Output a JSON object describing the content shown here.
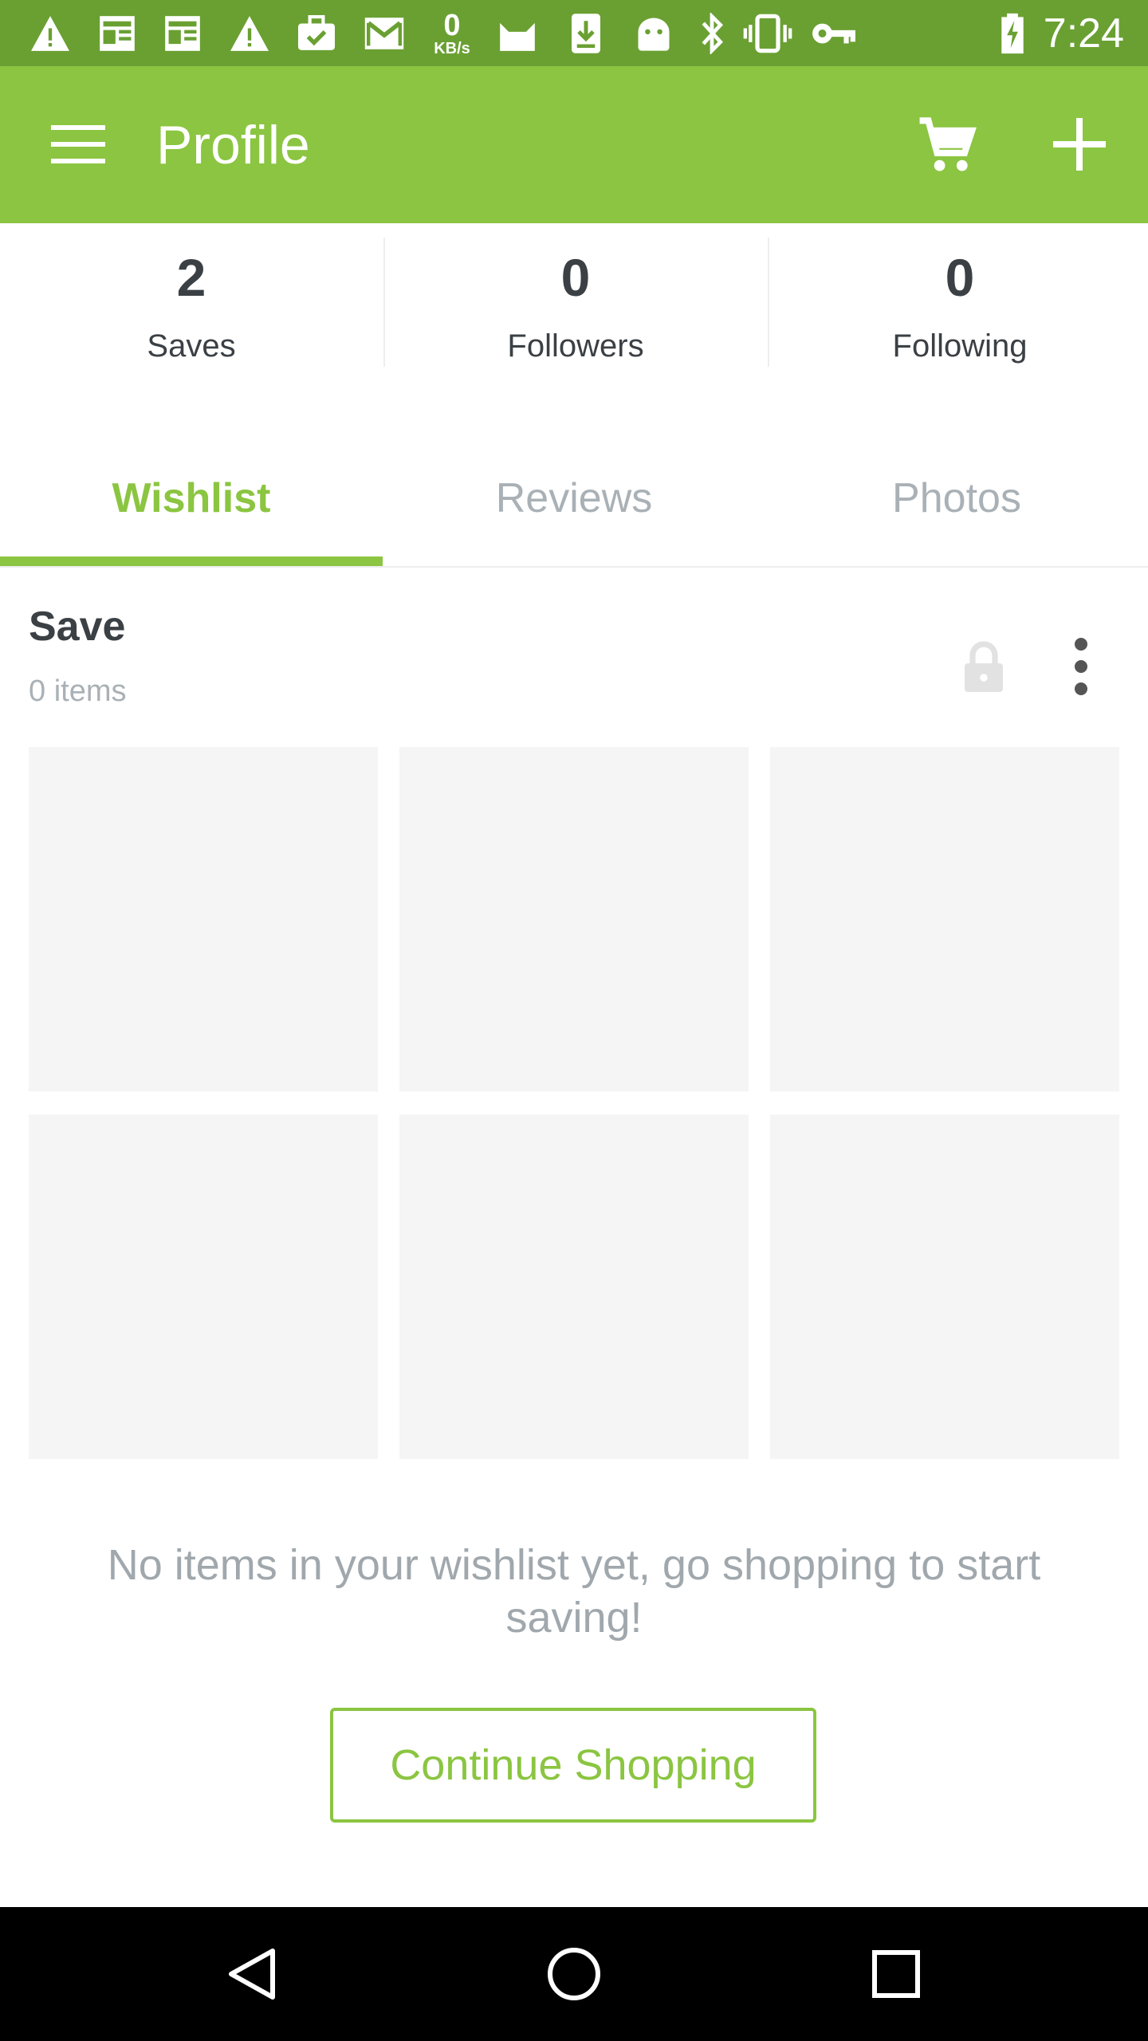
{
  "status_bar": {
    "time": "7:24",
    "net_speed_value": "0",
    "net_speed_unit": "KB/s",
    "icons": [
      "warning-icon",
      "news-icon",
      "news-icon",
      "warning-icon",
      "briefcase-icon",
      "gmail-icon",
      "net-speed",
      "cat-icon",
      "download-icon",
      "android-icon",
      "bluetooth-icon",
      "vibrate-icon",
      "key-icon",
      "battery-icon"
    ]
  },
  "app_bar": {
    "title": "Profile",
    "color": "#8bc541"
  },
  "stats": [
    {
      "value": "2",
      "label": "Saves"
    },
    {
      "value": "0",
      "label": "Followers"
    },
    {
      "value": "0",
      "label": "Following"
    }
  ],
  "tabs": [
    {
      "label": "Wishlist",
      "active": true
    },
    {
      "label": "Reviews",
      "active": false
    },
    {
      "label": "Photos",
      "active": false
    }
  ],
  "wishlist": {
    "title": "Save",
    "count": "0 items"
  },
  "empty_state": {
    "message": "No items in your wishlist yet, go shopping to start saving!",
    "button_label": "Continue Shopping"
  },
  "colors": {
    "accent": "#8bc541",
    "status_bar": "#6aa032",
    "text_dark": "#3b4045",
    "text_muted": "#a9b1b6",
    "placeholder": "#f5f5f5"
  }
}
